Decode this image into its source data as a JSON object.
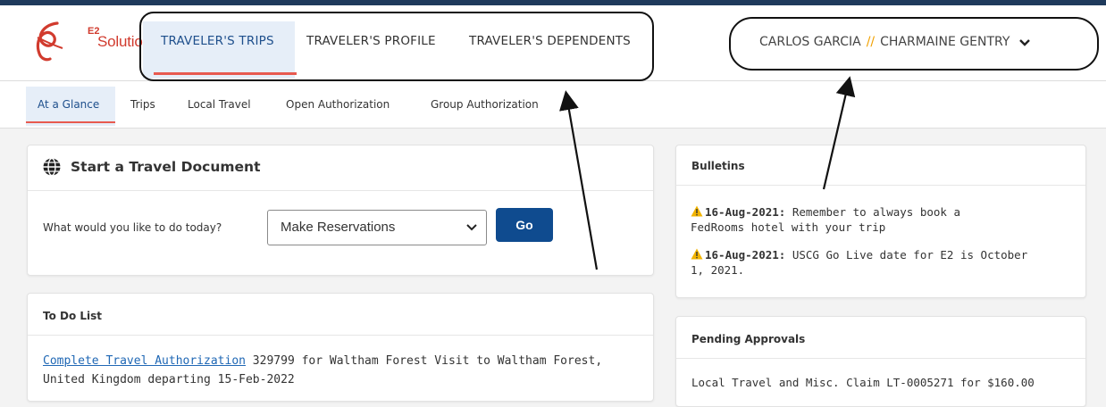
{
  "brand": {
    "sup": "E2",
    "name": "Solutions",
    "tm": "™"
  },
  "main_tabs": [
    {
      "label": "TRAVELER'S TRIPS",
      "active": true
    },
    {
      "label": "TRAVELER'S PROFILE",
      "active": false
    },
    {
      "label": "TRAVELER'S DEPENDENTS",
      "active": false
    }
  ],
  "user": {
    "name1": "CARLOS GARCIA",
    "separator": "//",
    "name2": "CHARMAINE GENTRY",
    "icon": "chevron-down-icon"
  },
  "sub_tabs": [
    {
      "label": "At a Glance",
      "active": true
    },
    {
      "label": "Trips",
      "active": false
    },
    {
      "label": "Local Travel",
      "active": false
    },
    {
      "label": "Open Authorization",
      "active": false
    },
    {
      "label": "Group Authorization",
      "active": false
    }
  ],
  "start_doc": {
    "icon": "globe-icon",
    "title": "Start a Travel Document",
    "prompt": "What would you like to do today?",
    "selected_option": "Make Reservations",
    "go_label": "Go"
  },
  "todo": {
    "title": "To Do List",
    "item_link": "Complete Travel Authorization",
    "item_text": " 329799 for Waltham Forest Visit to Waltham Forest,",
    "item_line2": "United Kingdom departing 15-Feb-2022"
  },
  "bulletins": {
    "title": "Bulletins",
    "items": [
      {
        "date": "16-Aug-2021:",
        "text": " Remember to always book a",
        "line2": "FedRooms hotel with your trip"
      },
      {
        "date": "16-Aug-2021:",
        "text": " USCG Go Live date for E2 is October",
        "line2": "1, 2021."
      }
    ]
  },
  "pending": {
    "title": "Pending Approvals",
    "first_line": "Local Travel and Misc. Claim LT-0005271 for $160.00"
  },
  "colors": {
    "accent": "#1e4f8c",
    "active_underline": "#e85a4f",
    "go_button": "#0f4b8f",
    "link": "#2068b5",
    "separator": "#f0a000"
  }
}
